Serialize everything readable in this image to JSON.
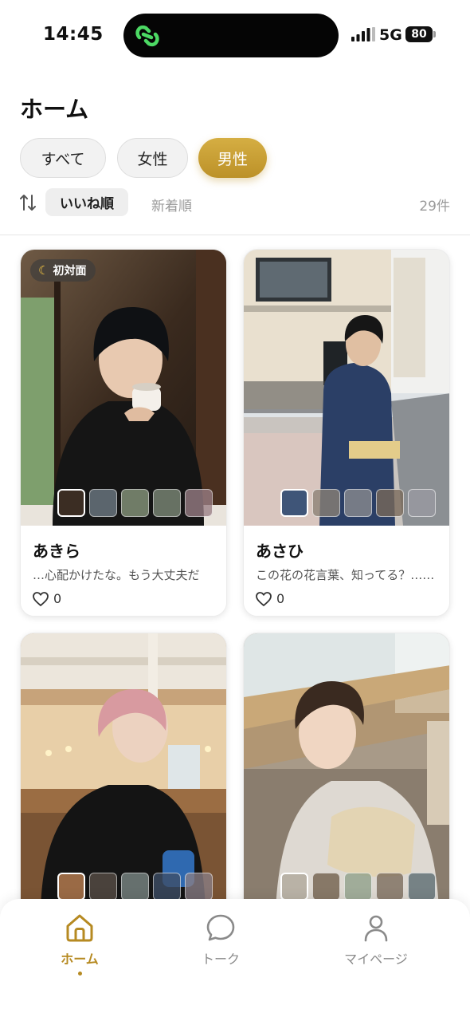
{
  "status_bar": {
    "time": "14:45",
    "network": "5G",
    "battery": "80"
  },
  "header": {
    "title": "ホーム"
  },
  "filters": [
    {
      "label": "すべて",
      "active": false
    },
    {
      "label": "女性",
      "active": false
    },
    {
      "label": "男性",
      "active": true
    }
  ],
  "sort": {
    "selected": "いいね順",
    "other": "新着順",
    "count": "29件"
  },
  "cards": [
    {
      "name": "あきら",
      "message": "…心配かけたな。もう大丈夫だ",
      "likes": "0",
      "badge": "初対面"
    },
    {
      "name": "あさひ",
      "message": "この花の花言葉、知ってる？……",
      "likes": "0"
    },
    {
      "name": "",
      "message": "",
      "likes": ""
    },
    {
      "name": "",
      "message": "",
      "likes": ""
    }
  ],
  "tabs": [
    {
      "label": "ホーム",
      "active": true,
      "icon": "home-icon"
    },
    {
      "label": "トーク",
      "active": false,
      "icon": "chat-bubble-icon"
    },
    {
      "label": "マイページ",
      "active": false,
      "icon": "person-icon"
    }
  ],
  "colors": {
    "accent": "#c29a30",
    "accent_dark": "#b68a22",
    "muted": "#9a9a9a"
  }
}
